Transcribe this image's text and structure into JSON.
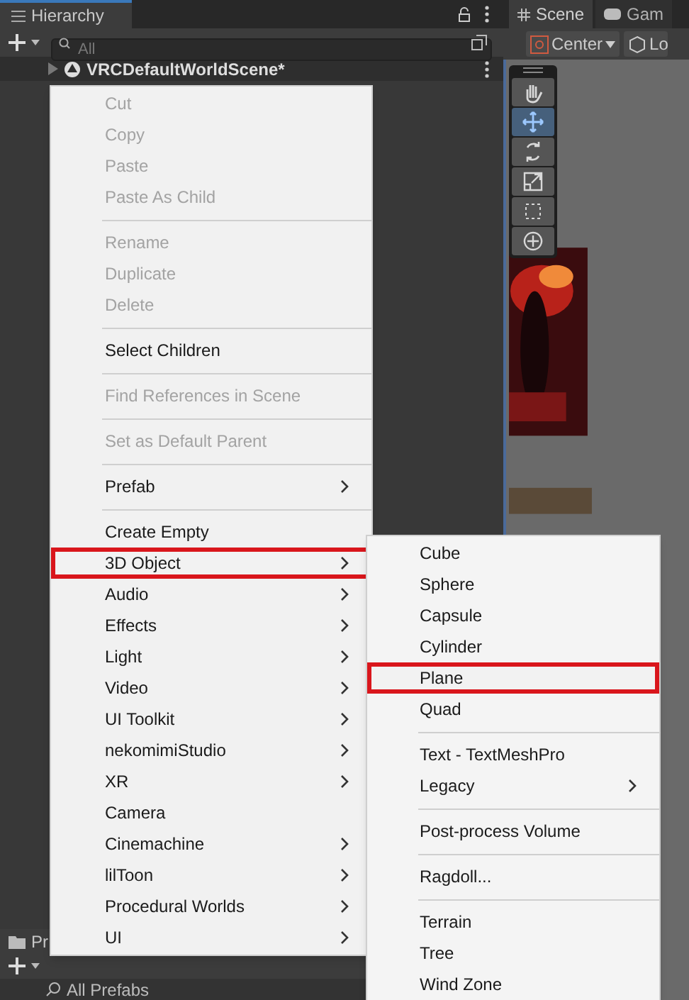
{
  "hierarchy": {
    "tab": "Hierarchy",
    "search_placeholder": "All",
    "scene_item": "VRCDefaultWorldScene*"
  },
  "scene": {
    "tabs": [
      {
        "label": "Scene",
        "selected": true
      },
      {
        "label": "Gam",
        "selected": false
      }
    ],
    "pivot_button": "Center",
    "handle_button": "Lo",
    "tools": [
      {
        "kind": "hand",
        "selected": false
      },
      {
        "kind": "move",
        "selected": true
      },
      {
        "kind": "rotate",
        "selected": false
      },
      {
        "kind": "scale",
        "selected": false
      },
      {
        "kind": "rect",
        "selected": false
      },
      {
        "kind": "transform",
        "selected": false
      }
    ]
  },
  "context_menu": [
    {
      "kind": "item",
      "label": "Cut",
      "disabled": true
    },
    {
      "kind": "item",
      "label": "Copy",
      "disabled": true
    },
    {
      "kind": "item",
      "label": "Paste",
      "disabled": true
    },
    {
      "kind": "item",
      "label": "Paste As Child",
      "disabled": true
    },
    {
      "kind": "separator"
    },
    {
      "kind": "item",
      "label": "Rename",
      "disabled": true
    },
    {
      "kind": "item",
      "label": "Duplicate",
      "disabled": true
    },
    {
      "kind": "item",
      "label": "Delete",
      "disabled": true
    },
    {
      "kind": "separator"
    },
    {
      "kind": "item",
      "label": "Select Children",
      "disabled": false
    },
    {
      "kind": "separator"
    },
    {
      "kind": "item",
      "label": "Find References in Scene",
      "disabled": true
    },
    {
      "kind": "separator"
    },
    {
      "kind": "item",
      "label": "Set as Default Parent",
      "disabled": true
    },
    {
      "kind": "separator"
    },
    {
      "kind": "item",
      "label": "Prefab",
      "disabled": false,
      "submenu": true
    },
    {
      "kind": "separator"
    },
    {
      "kind": "item",
      "label": "Create Empty",
      "disabled": false
    },
    {
      "kind": "item",
      "label": "3D Object",
      "disabled": false,
      "submenu": true,
      "highlighted": true
    },
    {
      "kind": "item",
      "label": "Audio",
      "disabled": false,
      "submenu": true
    },
    {
      "kind": "item",
      "label": "Effects",
      "disabled": false,
      "submenu": true
    },
    {
      "kind": "item",
      "label": "Light",
      "disabled": false,
      "submenu": true
    },
    {
      "kind": "item",
      "label": "Video",
      "disabled": false,
      "submenu": true
    },
    {
      "kind": "item",
      "label": "UI Toolkit",
      "disabled": false,
      "submenu": true
    },
    {
      "kind": "item",
      "label": "nekomimiStudio",
      "disabled": false,
      "submenu": true
    },
    {
      "kind": "item",
      "label": "XR",
      "disabled": false,
      "submenu": true
    },
    {
      "kind": "item",
      "label": "Camera",
      "disabled": false
    },
    {
      "kind": "item",
      "label": "Cinemachine",
      "disabled": false,
      "submenu": true
    },
    {
      "kind": "item",
      "label": "lilToon",
      "disabled": false,
      "submenu": true
    },
    {
      "kind": "item",
      "label": "Procedural Worlds",
      "disabled": false,
      "submenu": true
    },
    {
      "kind": "item",
      "label": "UI",
      "disabled": false,
      "submenu": true
    }
  ],
  "submenu": [
    {
      "kind": "item",
      "label": "Cube"
    },
    {
      "kind": "item",
      "label": "Sphere"
    },
    {
      "kind": "item",
      "label": "Capsule"
    },
    {
      "kind": "item",
      "label": "Cylinder"
    },
    {
      "kind": "item",
      "label": "Plane",
      "highlighted": true
    },
    {
      "kind": "item",
      "label": "Quad"
    },
    {
      "kind": "separator"
    },
    {
      "kind": "item",
      "label": "Text - TextMeshPro"
    },
    {
      "kind": "item",
      "label": "Legacy",
      "submenu": true
    },
    {
      "kind": "separator"
    },
    {
      "kind": "item",
      "label": "Post-process Volume"
    },
    {
      "kind": "separator"
    },
    {
      "kind": "item",
      "label": "Ragdoll..."
    },
    {
      "kind": "separator"
    },
    {
      "kind": "item",
      "label": "Terrain"
    },
    {
      "kind": "item",
      "label": "Tree"
    },
    {
      "kind": "item",
      "label": "Wind Zone"
    }
  ],
  "project": {
    "tab": "Pr",
    "filter": "All Prefabs"
  }
}
